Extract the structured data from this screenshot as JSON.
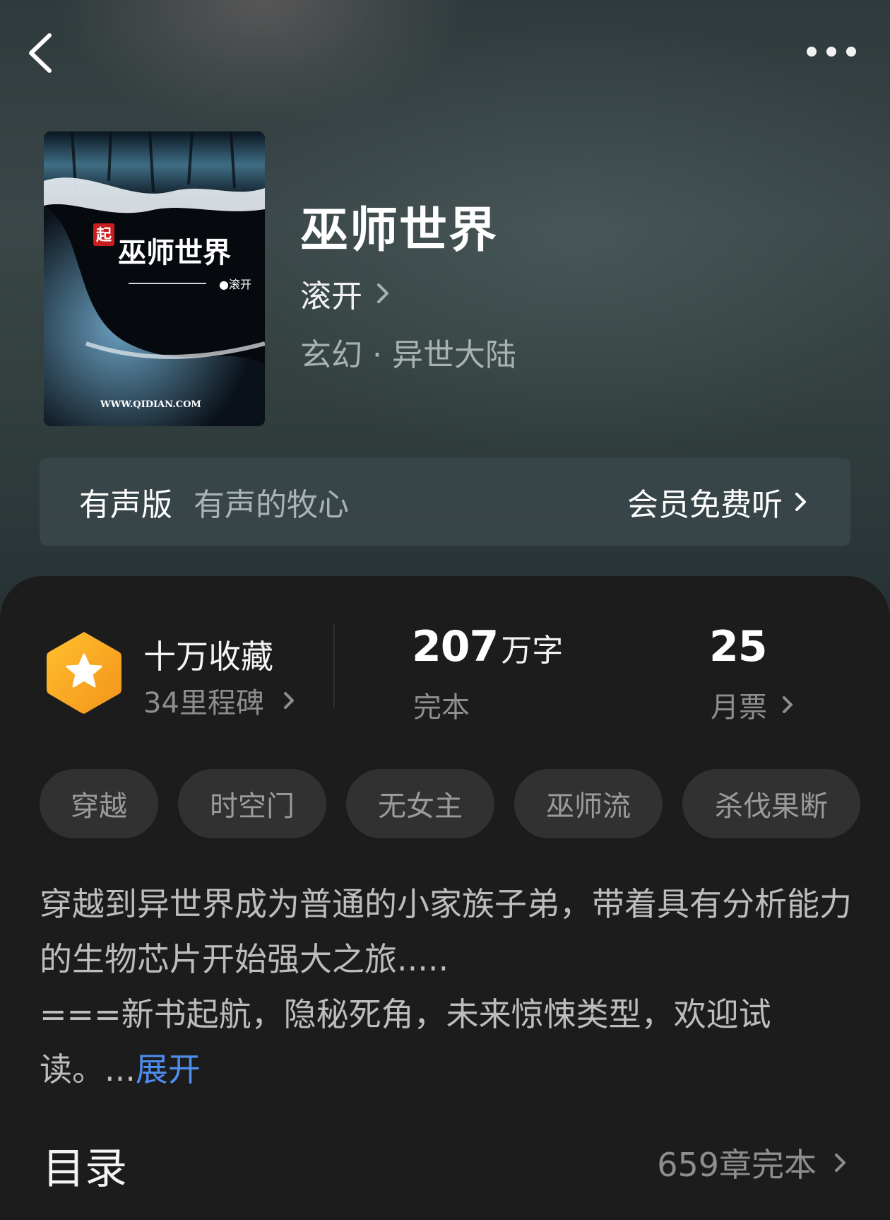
{
  "colors": {
    "accent_link": "#4d8ff0",
    "badge_orange": "#f5a623",
    "panel_bg": "#1c1c1d"
  },
  "nav": {
    "back_icon": "chevron-left-icon",
    "more_icon": "more-dots-icon"
  },
  "book": {
    "title": "巫师世界",
    "author": "滚开",
    "genre": "玄幻 · 异世大陆",
    "cover": {
      "title_text": "巫师世界",
      "publisher_mark": "起",
      "author_text": "●滚开",
      "url_text": "WWW.QIDIAN.COM"
    }
  },
  "audio": {
    "label": "有声版",
    "name": "有声的牧心",
    "cta": "会员免费听"
  },
  "stats": {
    "favorites": {
      "title": "十万收藏",
      "sub": "34里程碑"
    },
    "words": {
      "number": "207",
      "unit": "万字",
      "status": "完本"
    },
    "tickets": {
      "number": "25",
      "label": "月票"
    }
  },
  "tags": [
    "穿越",
    "时空门",
    "无女主",
    "巫师流",
    "杀伐果断"
  ],
  "description": {
    "line1": "穿越到异世界成为普通的小家族子弟，带着具有分析能力的生物芯片开始强大之旅.....",
    "line2": "===新书起航，隐秘死角，未来惊悚类型，欢迎试读。...",
    "expand": "展开"
  },
  "toc": {
    "title": "目录",
    "meta": "659章完本"
  }
}
